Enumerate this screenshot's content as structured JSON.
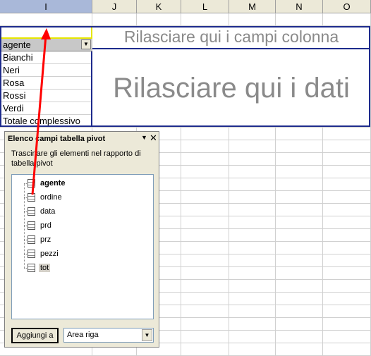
{
  "columns": [
    "I",
    "J",
    "K",
    "L",
    "M",
    "N",
    "O"
  ],
  "selected_column": "I",
  "pivot": {
    "column_drop_text": "Rilasciare qui i campi colonna",
    "data_drop_text": "Rilasciare qui i dati",
    "row_field_label": "agente",
    "row_items": [
      "Bianchi",
      "Neri",
      "Rosa",
      "Rossi",
      "Verdi"
    ],
    "grand_total_label": "Totale complessivo"
  },
  "panel": {
    "title": "Elenco campi tabella pivot",
    "instructions": "Trascinare gli elementi nel rapporto di tabella pivot",
    "fields": [
      "agente",
      "ordine",
      "data",
      "prd",
      "prz",
      "pezzi",
      "tot"
    ],
    "bold_field": "agente",
    "highlighted_field": "tot",
    "add_button_label": "Aggiungi a",
    "area_select_value": "Area riga",
    "menu_icon": "triangle-down",
    "close_icon": "x-close"
  },
  "colors": {
    "pivot_border": "#1e2b8c",
    "placeholder_text": "#8a8a8a",
    "drag_arrow": "#ff0000",
    "selected_cell_border": "#e6e600"
  }
}
